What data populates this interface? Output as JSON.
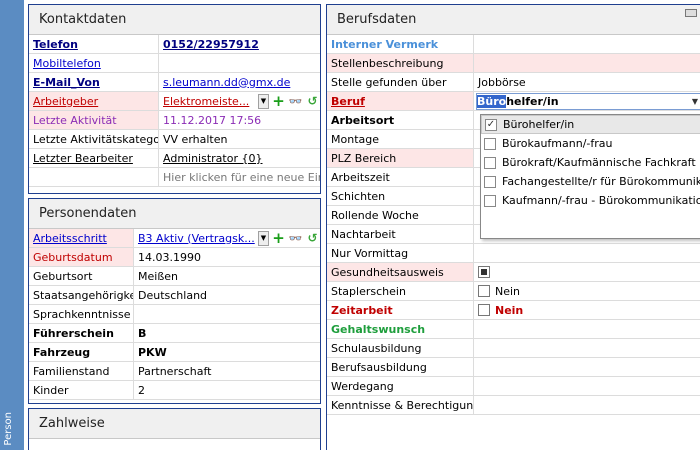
{
  "side": {
    "label": "Person"
  },
  "kontakt": {
    "title": "Kontaktdaten",
    "rows": [
      {
        "label": "Telefon",
        "value": "0152/22957912"
      },
      {
        "label": "Mobiltelefon",
        "value": ""
      },
      {
        "label": "E-Mail_Von",
        "value": "s.leumann.dd@gmx.de"
      },
      {
        "label": "Arbeitgeber",
        "value": "Elektromeiste..."
      },
      {
        "label": "Letzte Aktivität",
        "value": "11.12.2017 17:56"
      },
      {
        "label": "Letzte Aktivitätskategorie",
        "value": "VV erhalten"
      },
      {
        "label": "Letzter Bearbeiter",
        "value": "Administrator {0}"
      },
      {
        "label": "",
        "value": "Hier klicken für eine neue Ein..."
      }
    ]
  },
  "person": {
    "title": "Personendaten",
    "rows": [
      {
        "label": "Arbeitsschritt",
        "value": "B3 Aktiv (Vertragsk..."
      },
      {
        "label": "Geburtsdatum",
        "value": "14.03.1990"
      },
      {
        "label": "Geburtsort",
        "value": "Meißen"
      },
      {
        "label": "Staatsangehörigkeit",
        "value": "Deutschland"
      },
      {
        "label": "Sprachkenntnisse",
        "value": ""
      },
      {
        "label": "Führerschein",
        "value": "B"
      },
      {
        "label": "Fahrzeug",
        "value": "PKW"
      },
      {
        "label": "Familienstand",
        "value": "Partnerschaft"
      },
      {
        "label": "Kinder",
        "value": "2"
      }
    ]
  },
  "zahlweise": {
    "title": "Zahlweise"
  },
  "beruf": {
    "title": "Berufsdaten",
    "rows": [
      {
        "label": "Interner Vermerk",
        "value": ""
      },
      {
        "label": "Stellenbeschreibung",
        "value": ""
      },
      {
        "label": "Stelle gefunden über",
        "value": "Jobbörse"
      },
      {
        "label": "Beruf",
        "value_selected": "Büro",
        "value_rest": "helfer/in"
      },
      {
        "label": "Arbeitsort",
        "value": ""
      },
      {
        "label": "Montage",
        "value": ""
      },
      {
        "label": "PLZ Bereich",
        "value": ""
      },
      {
        "label": "Arbeitszeit",
        "value": ""
      },
      {
        "label": "Schichten",
        "value": ""
      },
      {
        "label": "Rollende Woche",
        "value": ""
      },
      {
        "label": "Nachtarbeit",
        "value": ""
      },
      {
        "label": "Nur Vormittag",
        "value": ""
      },
      {
        "label": "Gesundheitsausweis",
        "value": ""
      },
      {
        "label": "Staplerschein",
        "value": "Nein"
      },
      {
        "label": "Zeitarbeit",
        "value": "Nein"
      },
      {
        "label": "Gehaltswunsch",
        "value": ""
      },
      {
        "label": "Schulausbildung",
        "value": ""
      },
      {
        "label": "Berufsausbildung",
        "value": ""
      },
      {
        "label": "Werdegang",
        "value": ""
      },
      {
        "label": "Kenntnisse & Berechtigungen",
        "value": ""
      }
    ]
  },
  "beruf_dropdown": {
    "options": [
      {
        "label": "Bürohelfer/in",
        "checked": true
      },
      {
        "label": "Bürokaufmann/-frau",
        "checked": false
      },
      {
        "label": "Bürokraft/Kaufmännische Fachkraft",
        "checked": false
      },
      {
        "label": "Fachangestellte/r für Bürokommunikation",
        "checked": false
      },
      {
        "label": "Kaufmann/-frau - Bürokommunikation",
        "checked": false
      }
    ]
  }
}
